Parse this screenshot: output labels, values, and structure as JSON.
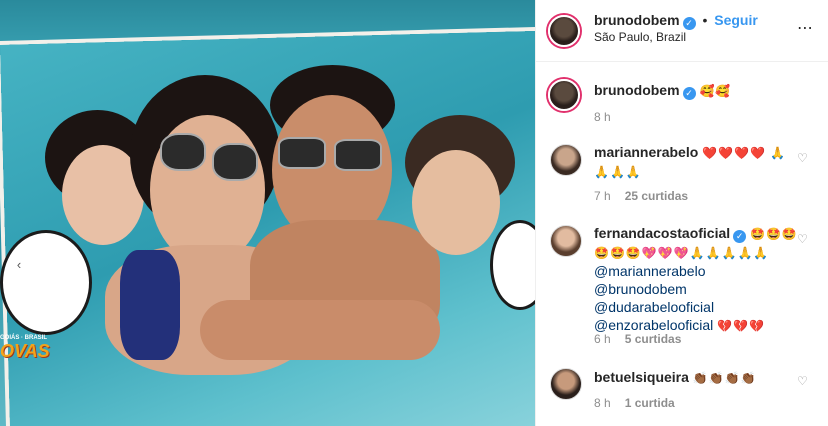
{
  "post": {
    "author": "brunodobem",
    "follow_label": "Seguir",
    "location": "São Paulo, Brazil",
    "caption_emojis": "🥰🥰",
    "caption_time": "8 h"
  },
  "photo": {
    "corner_text_1": "GOIÁS · BRASIL",
    "corner_text_2": "OVAS"
  },
  "comments": [
    {
      "user": "mariannerabelo",
      "text": "❤️❤️❤️❤️ 🙏🙏🙏🙏",
      "time": "7 h",
      "likes": "25 curtidas"
    },
    {
      "user": "fernandacosta​oficial",
      "text_line1": "🤩🤩🤩🤩🤩🤩💖💖💖🙏🙏🙏🙏🙏",
      "mentions": [
        "@mariannerabelo",
        "@brunodobem",
        "@dudarabelooficial",
        "@enzorabelooficial"
      ],
      "trailing_emojis": "💔💔💔",
      "time": "6 h",
      "likes": "5 curtidas"
    },
    {
      "user": "betuelsiqueira",
      "text": "👏🏾👏🏾👏🏾👏🏾",
      "time": "8 h",
      "likes": "1 curtida"
    }
  ],
  "icons": {
    "more": "more-options-icon",
    "heart": "heart-icon",
    "verified": "verified-badge-icon",
    "nav": "previous-arrow-icon"
  },
  "colors": {
    "link_blue": "#3897f0",
    "mention_blue": "#003569",
    "meta_gray": "#8e8e8e"
  }
}
